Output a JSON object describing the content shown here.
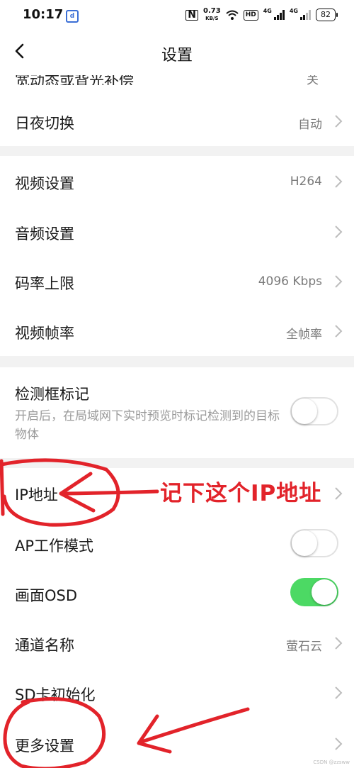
{
  "status_bar": {
    "time": "10:17",
    "net_speed_value": "0.73",
    "net_speed_unit": "KB/S",
    "hd_label": "HD",
    "network_label_1": "4G",
    "network_label_2": "4G",
    "battery": "82"
  },
  "header": {
    "title": "设置"
  },
  "partial_row": {
    "label": "宽动态或背光补偿",
    "value": "关"
  },
  "rows": {
    "day_night": {
      "label": "日夜切换",
      "value": "自动"
    },
    "video_settings": {
      "label": "视频设置",
      "value": "H264"
    },
    "audio_settings": {
      "label": "音频设置"
    },
    "bitrate_limit": {
      "label": "码率上限",
      "value": "4096 Kbps"
    },
    "video_fps": {
      "label": "视频帧率",
      "value": "全帧率"
    },
    "detect_box": {
      "label": "检测框标记",
      "description": "开启后，在局域网下实时预览时标记检测到的目标物体",
      "on": false
    },
    "ip_address": {
      "label": "IP地址"
    },
    "ap_mode": {
      "label": "AP工作模式",
      "on": false
    },
    "osd": {
      "label": "画面OSD",
      "on": true
    },
    "channel_name": {
      "label": "通道名称",
      "value": "萤石云"
    },
    "sd_init": {
      "label": "SD卡初始化"
    },
    "more_settings": {
      "label": "更多设置"
    }
  },
  "annotation": {
    "text": "记下这个IP地址"
  },
  "watermark": "CSDN @zzsww",
  "colors": {
    "toggle_on": "#4cd964",
    "annotation_red": "#e2232a",
    "separator": "#f2f2f2"
  }
}
